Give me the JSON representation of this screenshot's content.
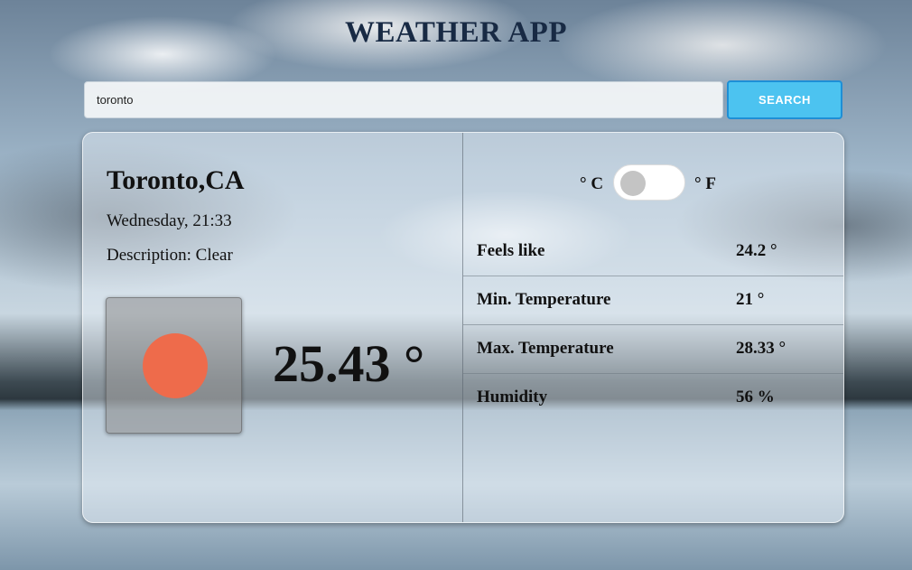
{
  "header": {
    "title": "WEATHER APP"
  },
  "search": {
    "value": "toronto",
    "button_label": "SEARCH"
  },
  "current": {
    "city": "Toronto,CA",
    "datetime": "Wednesday, 21:33",
    "description": "Description: Clear",
    "icon": "sun-icon",
    "temperature": "25.43 °"
  },
  "units": {
    "celsius_label": "° C",
    "fahrenheit_label": "° F",
    "selected": "C"
  },
  "stats": [
    {
      "label": "Feels like",
      "value": "24.2 °"
    },
    {
      "label": "Min. Temperature",
      "value": "21 °"
    },
    {
      "label": "Max. Temperature",
      "value": "28.33 °"
    },
    {
      "label": "Humidity",
      "value": "56 %"
    }
  ],
  "colors": {
    "title": "#182a44",
    "search_button": "#4cc3f0",
    "sun": "#ee6b4b"
  }
}
